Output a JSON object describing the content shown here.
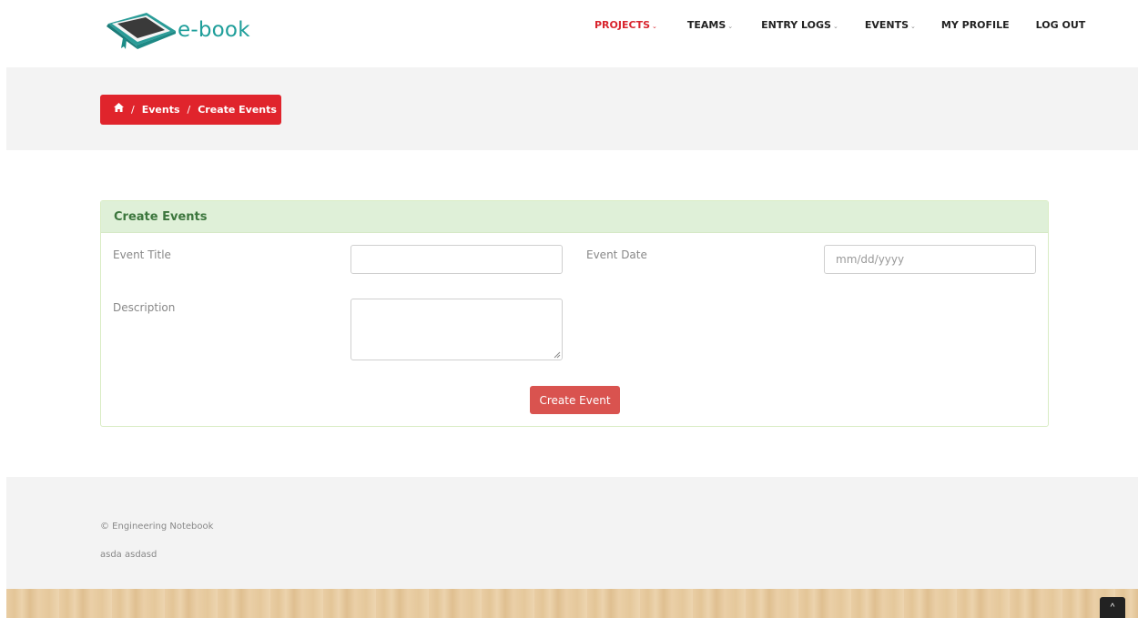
{
  "header": {
    "logo_text": "e-book",
    "nav": [
      {
        "label": "PROJECTS",
        "active": true,
        "dropdown": true
      },
      {
        "label": "TEAMS",
        "active": false,
        "dropdown": true
      },
      {
        "label": "ENTRY LOGS",
        "active": false,
        "dropdown": true
      },
      {
        "label": "EVENTS",
        "active": false,
        "dropdown": true
      },
      {
        "label": "MY PROFILE",
        "active": false,
        "dropdown": false
      },
      {
        "label": "LOG OUT",
        "active": false,
        "dropdown": false
      }
    ]
  },
  "breadcrumb": {
    "icon": "home-icon",
    "items": [
      "Events",
      "Create Events"
    ],
    "separator": "/"
  },
  "panel": {
    "title": "Create Events",
    "fields": {
      "event_title": {
        "label": "Event Title",
        "value": ""
      },
      "event_date": {
        "label": "Event Date",
        "placeholder": "mm/dd/yyyy",
        "value": ""
      },
      "description": {
        "label": "Description",
        "value": ""
      }
    },
    "submit_label": "Create Event"
  },
  "footer": {
    "copyright": "© Engineering Notebook",
    "text": "asda asdasd"
  },
  "scroll_top": {
    "icon": "chevron-up-icon",
    "glyph": "^"
  },
  "colors": {
    "accent": "#e0242c",
    "button": "#d9534f",
    "panel_header_bg": "#dff0d8",
    "panel_header_text": "#3c763d",
    "logo_teal": "#1e9e9a"
  }
}
